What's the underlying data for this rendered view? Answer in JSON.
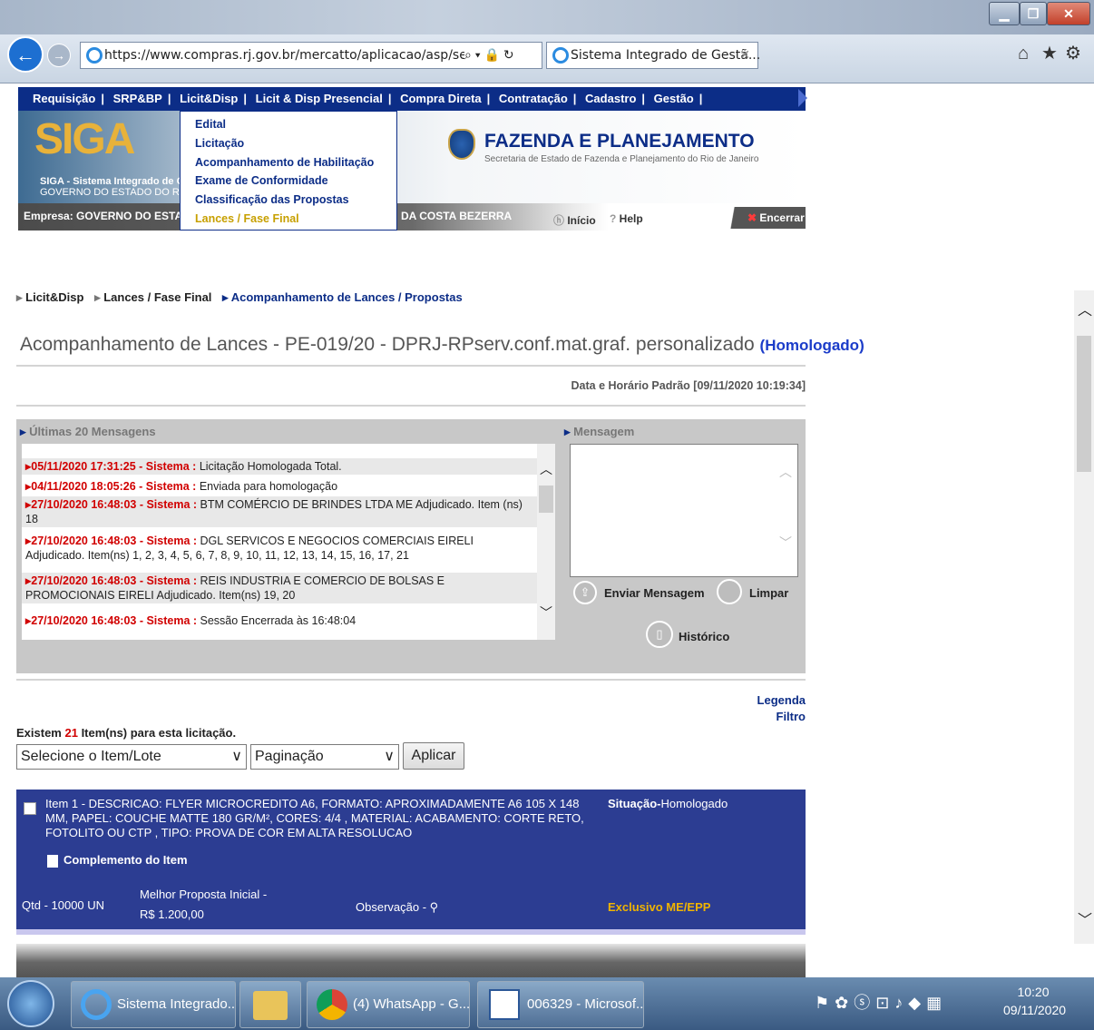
{
  "browser": {
    "url": "https://www.compras.rj.gov.br/mercatto/aplicacao/asp/seg/sist",
    "tab_title": "Sistema Integrado de Gestã...",
    "search_glyph": "⌕ ▾ 🔒 ↻"
  },
  "menu": {
    "items": [
      "Requisição",
      "SRP&BP",
      "Licit&Disp",
      "Licit & Disp Presencial",
      "Compra Direta",
      "Contratação",
      "Cadastro",
      "Gestão"
    ],
    "separator": "|",
    "dropdown": [
      "Edital",
      "Licitação",
      "Acompanhamento de Habilitação",
      "Exame de Conformidade",
      "Classificação das Propostas",
      "Lances / Fase Final"
    ]
  },
  "banner": {
    "logo": "SIGA",
    "siga_line1": "SIGA - Sistema Integrado de Ge",
    "siga_line2": "GOVERNO DO ESTADO DO RI",
    "org_title": "FAZENDA E PLANEJAMENTO",
    "org_subtitle": "Secretaria de Estado de Fazenda e Planejamento do Rio de Janeiro",
    "empresa": "Empresa: GOVERNO DO ESTADO",
    "user_tail": "DA COSTA BEZERRA",
    "inicio": "Início",
    "help": "Help",
    "encerrar": "Encerrar"
  },
  "breadcrumb": {
    "b1": "Licit&Disp",
    "b2": "Lances / Fase Final",
    "b3": "Acompanhamento de Lances / Propostas"
  },
  "title": {
    "main": "Acompanhamento de Lances - PE-019/20 -  DPRJ-RPserv.conf.mat.graf. personalizado",
    "status": "(Homologado)"
  },
  "datetime": "Data e Horário Padrão [09/11/2020 10:19:34]",
  "messages_panel": {
    "header": "Últimas 20 Mensagens",
    "messages": [
      {
        "ts": "05/11/2020 17:31:25 - Sistema :",
        "text": " Licitação Homologada Total."
      },
      {
        "ts": "04/11/2020 18:05:26 - Sistema :",
        "text": " Enviada para homologação"
      },
      {
        "ts": "27/10/2020 16:48:03 - Sistema :",
        "text": " BTM COMÉRCIO DE BRINDES LTDA ME Adjudicado. Item (ns) 18"
      },
      {
        "ts": "27/10/2020 16:48:03 - Sistema :",
        "text": " DGL SERVICOS E NEGOCIOS COMERCIAIS EIRELI Adjudicado. Item(ns) 1, 2, 3, 4, 5, 6, 7, 8, 9, 10, 11, 12, 13, 14, 15, 16, 17, 21"
      },
      {
        "ts": "27/10/2020 16:48:03 - Sistema :",
        "text": " REIS INDUSTRIA E COMERCIO DE BOLSAS E PROMOCIONAIS EIRELI Adjudicado. Item(ns) 19, 20"
      },
      {
        "ts": "27/10/2020 16:48:03 - Sistema :",
        "text": " Sessão Encerrada às 16:48:04"
      }
    ],
    "compose_header": "Mensagem",
    "send": "Enviar Mensagem",
    "clear": "Limpar",
    "history": "Histórico"
  },
  "links": {
    "legenda": "Legenda",
    "filtro": "Filtro"
  },
  "items_count": {
    "pre": "Existem ",
    "count": "21",
    "post": " Item(ns) para esta licitação."
  },
  "filters": {
    "item_select": "Selecione o Item/Lote",
    "paging_select": "Paginação",
    "apply": "Aplicar"
  },
  "item": {
    "description": "Item 1 - DESCRICAO: FLYER MICROCREDITO A6, FORMATO: APROXIMADAMENTE A6 105 X 148 MM, PAPEL: COUCHE MATTE 180 GR/M², CORES: 4/4 , MATERIAL: ACABAMENTO: CORTE RETO, FOTOLITO OU CTP , TIPO: PROVA DE COR EM ALTA RESOLUCAO",
    "situacao_label": "Situação-",
    "situacao_value": "Homologado",
    "complemento": "Complemento do Item",
    "qtd": "Qtd - 10000 UN",
    "melhor_label": "Melhor Proposta Inicial -",
    "melhor_value": "R$  1.200,00",
    "observacao": "Observação -",
    "exclusivo": "Exclusivo ME/EPP"
  },
  "taskbar": {
    "apps": [
      "Sistema Integrado...",
      "(4) WhatsApp - G...",
      "006329 - Microsof..."
    ],
    "time": "10:20",
    "date": "09/11/2020"
  },
  "colors": {
    "menu_blue": "#0c2d87",
    "timestamp_red": "#d10000",
    "item_panel": "#2c3d92",
    "exclusivo": "#f0b400"
  }
}
